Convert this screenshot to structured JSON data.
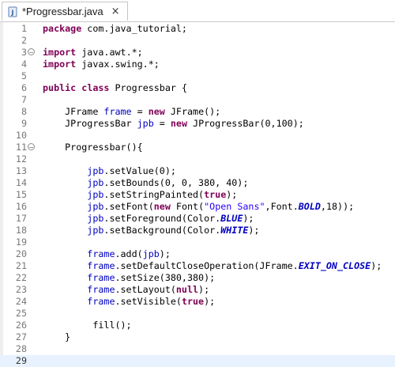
{
  "tab": {
    "title": "*Progressbar.java",
    "close": "×"
  },
  "code_lines": [
    {
      "n": "1",
      "fold": false,
      "tokens": [
        [
          "kw",
          "package"
        ],
        [
          "t",
          " com.java_tutorial;"
        ]
      ]
    },
    {
      "n": "2",
      "fold": false,
      "tokens": []
    },
    {
      "n": "3",
      "fold": true,
      "tokens": [
        [
          "kw",
          "import"
        ],
        [
          "t",
          " java.awt.*;"
        ]
      ]
    },
    {
      "n": "4",
      "fold": false,
      "tokens": [
        [
          "kw",
          "import"
        ],
        [
          "t",
          " javax.swing.*;"
        ]
      ]
    },
    {
      "n": "5",
      "fold": false,
      "tokens": []
    },
    {
      "n": "6",
      "fold": false,
      "tokens": [
        [
          "kw",
          "public"
        ],
        [
          "t",
          " "
        ],
        [
          "kw",
          "class"
        ],
        [
          "t",
          " Progressbar {"
        ]
      ]
    },
    {
      "n": "7",
      "fold": false,
      "tokens": []
    },
    {
      "n": "8",
      "fold": false,
      "tokens": [
        [
          "t",
          "    JFrame "
        ],
        [
          "fld",
          "frame"
        ],
        [
          "t",
          " = "
        ],
        [
          "kw",
          "new"
        ],
        [
          "t",
          " JFrame();"
        ]
      ]
    },
    {
      "n": "9",
      "fold": false,
      "tokens": [
        [
          "t",
          "    JProgressBar "
        ],
        [
          "fld",
          "jpb"
        ],
        [
          "t",
          " = "
        ],
        [
          "kw",
          "new"
        ],
        [
          "t",
          " JProgressBar(0,100);"
        ]
      ]
    },
    {
      "n": "10",
      "fold": false,
      "tokens": []
    },
    {
      "n": "11",
      "fold": true,
      "tokens": [
        [
          "t",
          "    Progressbar(){"
        ]
      ]
    },
    {
      "n": "12",
      "fold": false,
      "tokens": []
    },
    {
      "n": "13",
      "fold": false,
      "tokens": [
        [
          "t",
          "        "
        ],
        [
          "fld",
          "jpb"
        ],
        [
          "t",
          ".setValue(0);"
        ]
      ]
    },
    {
      "n": "14",
      "fold": false,
      "tokens": [
        [
          "t",
          "        "
        ],
        [
          "fld",
          "jpb"
        ],
        [
          "t",
          ".setBounds(0, 0, 380, 40);"
        ]
      ]
    },
    {
      "n": "15",
      "fold": false,
      "tokens": [
        [
          "t",
          "        "
        ],
        [
          "fld",
          "jpb"
        ],
        [
          "t",
          ".setStringPainted("
        ],
        [
          "kw",
          "true"
        ],
        [
          "t",
          ");"
        ]
      ]
    },
    {
      "n": "16",
      "fold": false,
      "tokens": [
        [
          "t",
          "        "
        ],
        [
          "fld",
          "jpb"
        ],
        [
          "t",
          ".setFont("
        ],
        [
          "kw",
          "new"
        ],
        [
          "t",
          " Font("
        ],
        [
          "str",
          "\"Open Sans\""
        ],
        [
          "t",
          ",Font."
        ],
        [
          "st",
          "BOLD"
        ],
        [
          "t",
          ",18));"
        ]
      ]
    },
    {
      "n": "17",
      "fold": false,
      "tokens": [
        [
          "t",
          "        "
        ],
        [
          "fld",
          "jpb"
        ],
        [
          "t",
          ".setForeground(Color."
        ],
        [
          "st",
          "BLUE"
        ],
        [
          "t",
          ");"
        ]
      ]
    },
    {
      "n": "18",
      "fold": false,
      "tokens": [
        [
          "t",
          "        "
        ],
        [
          "fld",
          "jpb"
        ],
        [
          "t",
          ".setBackground(Color."
        ],
        [
          "st",
          "WHITE"
        ],
        [
          "t",
          ");"
        ]
      ]
    },
    {
      "n": "19",
      "fold": false,
      "tokens": []
    },
    {
      "n": "20",
      "fold": false,
      "tokens": [
        [
          "t",
          "        "
        ],
        [
          "fld",
          "frame"
        ],
        [
          "t",
          ".add("
        ],
        [
          "fld",
          "jpb"
        ],
        [
          "t",
          ");"
        ]
      ]
    },
    {
      "n": "21",
      "fold": false,
      "tokens": [
        [
          "t",
          "        "
        ],
        [
          "fld",
          "frame"
        ],
        [
          "t",
          ".setDefaultCloseOperation(JFrame."
        ],
        [
          "st",
          "EXIT_ON_CLOSE"
        ],
        [
          "t",
          ");"
        ]
      ]
    },
    {
      "n": "22",
      "fold": false,
      "tokens": [
        [
          "t",
          "        "
        ],
        [
          "fld",
          "frame"
        ],
        [
          "t",
          ".setSize(380,380);"
        ]
      ]
    },
    {
      "n": "23",
      "fold": false,
      "tokens": [
        [
          "t",
          "        "
        ],
        [
          "fld",
          "frame"
        ],
        [
          "t",
          ".setLayout("
        ],
        [
          "kw",
          "null"
        ],
        [
          "t",
          ");"
        ]
      ]
    },
    {
      "n": "24",
      "fold": false,
      "tokens": [
        [
          "t",
          "        "
        ],
        [
          "fld",
          "frame"
        ],
        [
          "t",
          ".setVisible("
        ],
        [
          "kw",
          "true"
        ],
        [
          "t",
          ");"
        ]
      ]
    },
    {
      "n": "25",
      "fold": false,
      "tokens": []
    },
    {
      "n": "26",
      "fold": false,
      "tokens": [
        [
          "t",
          "         fill();"
        ]
      ]
    },
    {
      "n": "27",
      "fold": false,
      "tokens": [
        [
          "t",
          "    }"
        ]
      ]
    },
    {
      "n": "28",
      "fold": false,
      "tokens": []
    },
    {
      "n": "29",
      "fold": false,
      "tokens": [],
      "current": true
    }
  ],
  "colors": {
    "keyword": "#7f0055",
    "field": "#0000c0",
    "string": "#2a00ff",
    "line_number": "#787878",
    "current_line": "#e8f2fe"
  },
  "icons": {
    "tab_file": "java-file-icon",
    "fold": "fold-minus-icon",
    "close": "close-icon"
  }
}
